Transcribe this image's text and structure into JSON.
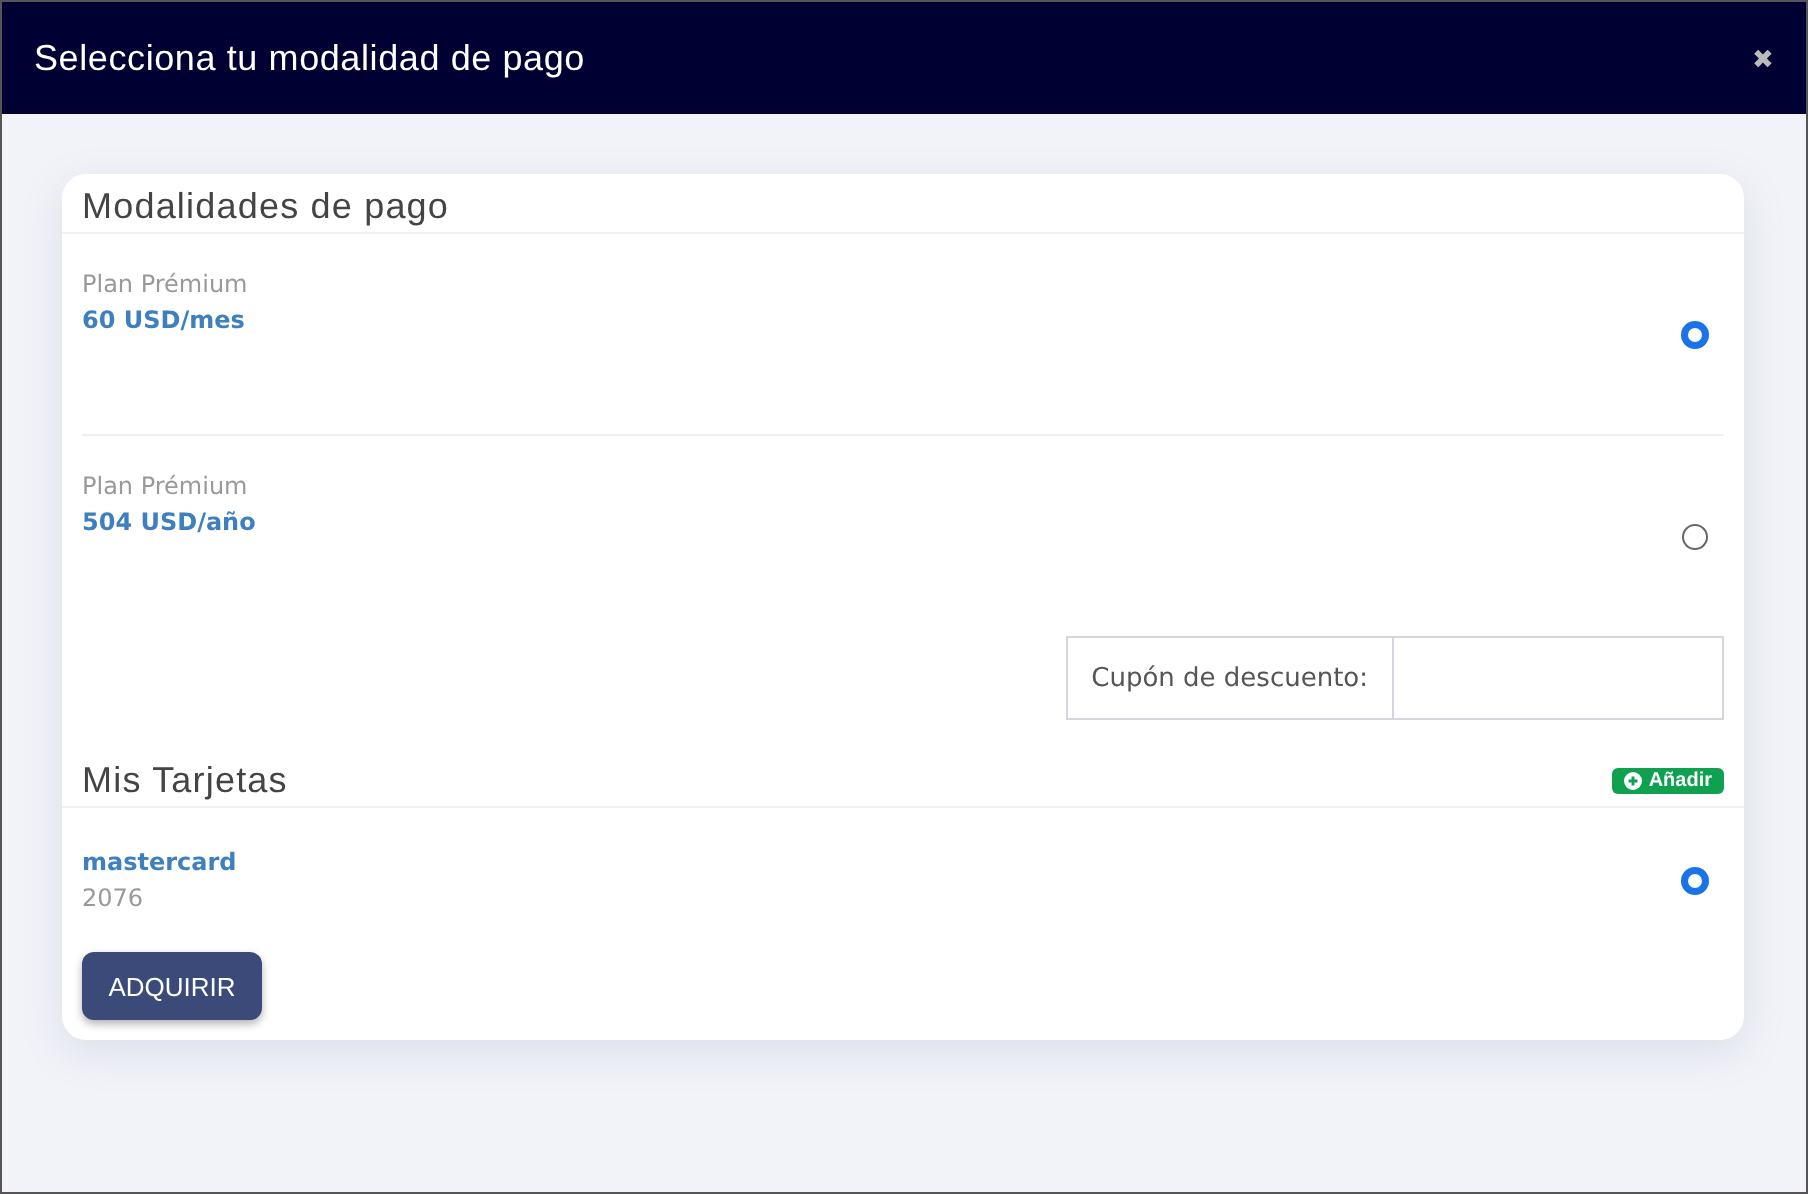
{
  "dialog": {
    "title": "Selecciona tu modalidad de pago",
    "close": "✖"
  },
  "payment_section": {
    "title": "Modalidades de pago",
    "plans": [
      {
        "name": "Plan Prémium",
        "price": "60 USD/mes",
        "selected": true
      },
      {
        "name": "Plan Prémium",
        "price": "504 USD/año",
        "selected": false
      }
    ],
    "coupon": {
      "label": "Cupón de descuento:"
    }
  },
  "cards_section": {
    "title": "Mis Tarjetas",
    "add_button": "Añadir",
    "cards": [
      {
        "brand": "mastercard",
        "number": "2076",
        "selected": true
      }
    ]
  },
  "submit_button": "ADQUIRIR"
}
